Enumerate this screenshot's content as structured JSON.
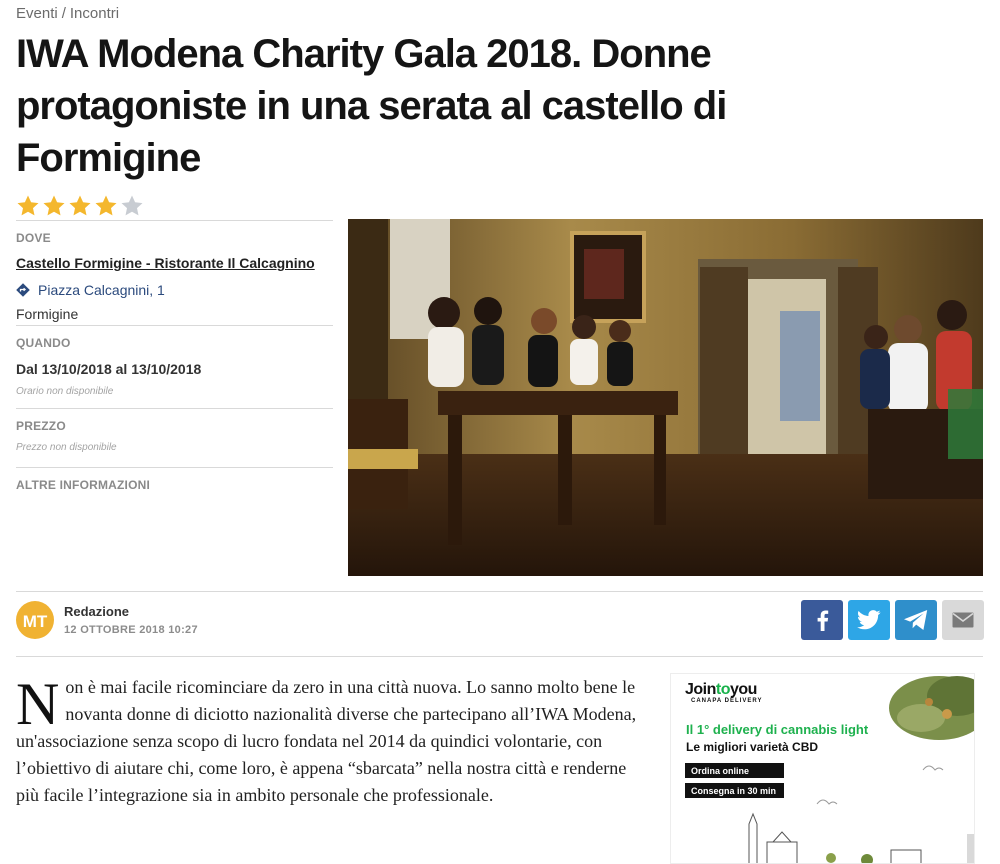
{
  "breadcrumb": {
    "section": "Eventi",
    "separator": "/",
    "subsection": "Incontri"
  },
  "event": {
    "title": "IWA Modena Charity Gala 2018. Donne protagoniste in una serata al castello di Formigine",
    "rating": {
      "value": 4,
      "max": 5
    }
  },
  "info": {
    "where_label": "DOVE",
    "venue": "Castello Formigine - Ristorante Il Calcagnino",
    "address": "Piazza Calcagnini, 1",
    "city": "Formigine",
    "when_label": "QUANDO",
    "dates": "Dal 13/10/2018 al 13/10/2018",
    "hours": "Orario non disponibile",
    "price_label": "PREZZO",
    "price": "Prezzo non disponibile",
    "more_label": "ALTRE INFORMAZIONI"
  },
  "author": {
    "initials": "MT",
    "name": "Redazione",
    "date": "12 OTTOBRE 2018 10:27"
  },
  "share": {
    "icons": [
      "facebook-icon",
      "twitter-icon",
      "telegram-icon",
      "email-icon"
    ]
  },
  "article": {
    "dropcap": "N",
    "body": "on è mai facile ricominciare da zero in una città nuova. Lo sanno molto bene le novanta donne di diciotto nazionalità diverse che partecipano all’IWA Modena, un'associazione senza scopo di lucro fondata nel 2014 da quindici volontarie, con l’obiettivo di aiutare chi, come loro, è appena “sbarcata” nella nostra città e renderne più facile l’integrazione sia in ambito personale che professionale."
  },
  "ad": {
    "logo_join": "Join",
    "logo_to": "to",
    "logo_you": "you",
    "logo_sub": "CANAPA DELIVERY",
    "headline": "Il 1° delivery di cannabis light",
    "tagline": "Le migliori varietà CBD",
    "button1": "Ordina online",
    "button2": "Consegna in 30 min"
  },
  "colors": {
    "star": "#f4b72d",
    "star_empty": "#c8ccd2",
    "facebook": "#3a5a9a",
    "twitter": "#2ea6e6",
    "telegram": "#2f8fcb",
    "email": "#d9d9d9",
    "address_link": "#2b4a7d",
    "ad_green": "#1eb14e"
  }
}
